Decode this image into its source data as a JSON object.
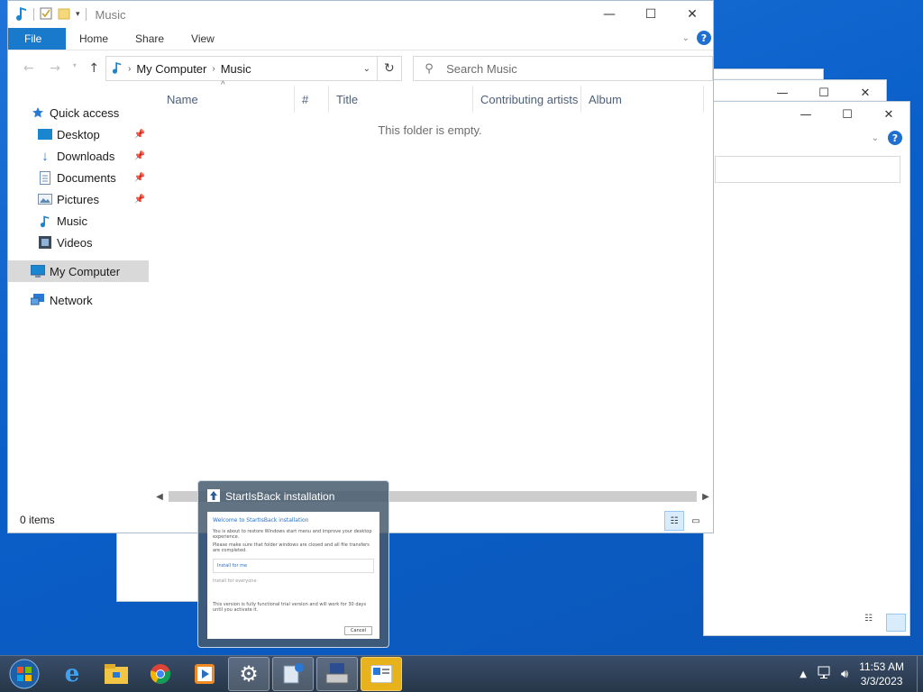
{
  "window": {
    "title": "Music",
    "ribbon_tabs": [
      "File",
      "Home",
      "Share",
      "View"
    ],
    "help": "?",
    "breadcrumb": [
      "My Computer",
      "Music"
    ],
    "search_placeholder": "Search Music",
    "columns": [
      "Name",
      "#",
      "Title",
      "Contributing artists",
      "Album"
    ],
    "empty_message": "This folder is empty.",
    "status": "0 items"
  },
  "nav": {
    "quick_access": "Quick access",
    "items": [
      {
        "label": "Desktop",
        "icon": "desktop-icon",
        "pinned": true
      },
      {
        "label": "Downloads",
        "icon": "downloads-icon",
        "pinned": true
      },
      {
        "label": "Documents",
        "icon": "documents-icon",
        "pinned": true
      },
      {
        "label": "Pictures",
        "icon": "pictures-icon",
        "pinned": true
      },
      {
        "label": "Music",
        "icon": "music-icon",
        "pinned": false
      },
      {
        "label": "Videos",
        "icon": "videos-icon",
        "pinned": false
      }
    ],
    "my_computer": "My Computer",
    "network": "Network"
  },
  "thumbnail": {
    "title": "StartIsBack installation",
    "preview_heading": "Welcome to StartIsBack installation",
    "preview_line1": "You is about to restore Windows start menu and improve your desktop experience.",
    "preview_line2": "Please make sure that folder windows are closed and all file transfers are completed.",
    "preview_option1": "Install for me",
    "preview_option2": "Install for everyone",
    "preview_footer": "This version is fully functional trial version and will work for 30 days until you activate it.",
    "preview_cancel": "Cancel"
  },
  "taskbar": {
    "time": "11:53 AM",
    "date": "3/3/2023"
  },
  "colors": {
    "accent": "#1979ca",
    "desktop": "#0a5fc9"
  }
}
